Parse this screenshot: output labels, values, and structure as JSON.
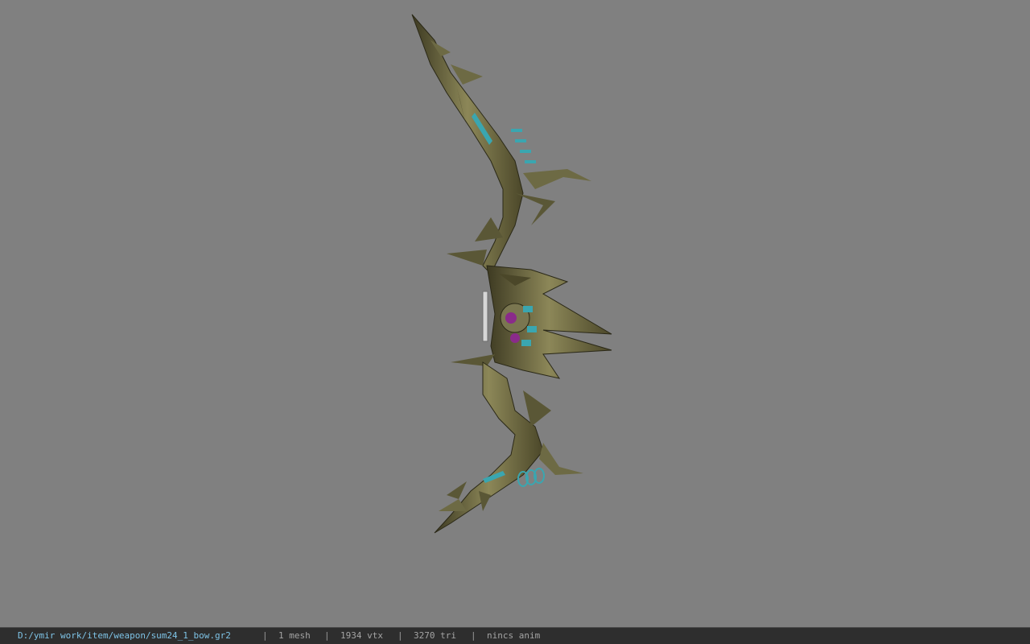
{
  "viewport": {
    "background": "#808080",
    "model": {
      "icon": "ornate-bow-model",
      "accent_colors": {
        "metal": "#6d6a44",
        "gem": "#3aa6b0",
        "eye": "#8a2b8a"
      }
    }
  },
  "status_bar": {
    "file_path": "D:/ymir work/item/weapon/sum24_1_bow.gr2",
    "separator": "|",
    "mesh_count": "1 mesh",
    "vertex_count": "1934 vtx",
    "triangle_count": "3270 tri",
    "anim_status": "nincs anim"
  }
}
